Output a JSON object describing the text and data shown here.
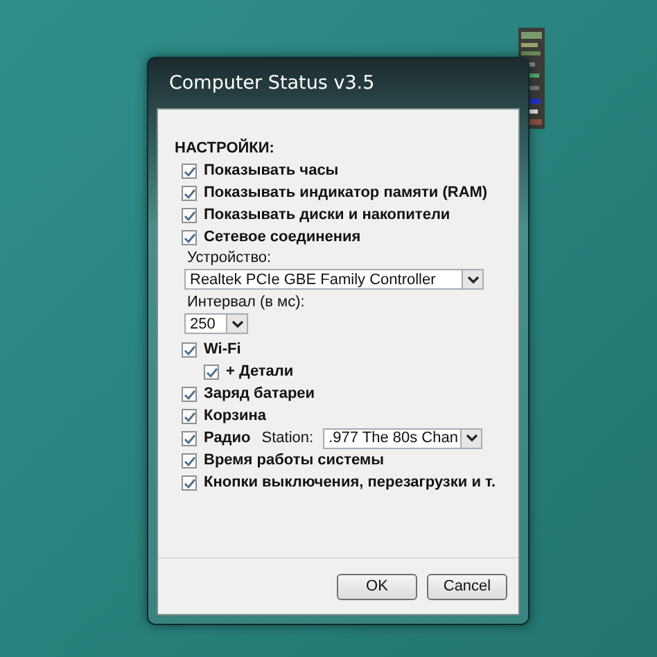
{
  "window": {
    "title": "Computer Status v3.5"
  },
  "section_title": "НАСТРОЙКИ:",
  "options": [
    {
      "kind": "checkbox",
      "label": "Показывать часы",
      "checked": true
    },
    {
      "kind": "checkbox",
      "label": "Показывать индикатор памяти (RAM)",
      "checked": true
    },
    {
      "kind": "checkbox",
      "label": "Показывать диски и накопители",
      "checked": true
    },
    {
      "kind": "checkbox",
      "label": "Сетевое соединения",
      "checked": true
    },
    {
      "kind": "device-select",
      "label": "Устройство:",
      "value": "Realtek PCIe GBE Family Controller"
    },
    {
      "kind": "interval-select",
      "label": "Интервал (в мс):",
      "value": "250"
    },
    {
      "kind": "checkbox",
      "label": "Wi-Fi",
      "checked": true,
      "children": [
        {
          "label": "+ Детали",
          "checked": true
        }
      ]
    },
    {
      "kind": "checkbox",
      "label": "Заряд батареи",
      "checked": true
    },
    {
      "kind": "checkbox",
      "label": "Корзина",
      "checked": true
    },
    {
      "kind": "radio-checkbox",
      "label": "Радио",
      "checked": true,
      "station_label": "Station:",
      "station": ".977 The 80s Chan"
    },
    {
      "kind": "checkbox",
      "label": "Время работы системы",
      "checked": true
    },
    {
      "kind": "checkbox",
      "label": "Кнопки выключения, перезагрузки и т.",
      "checked": true
    }
  ],
  "buttons": [
    "OK",
    "Cancel"
  ]
}
